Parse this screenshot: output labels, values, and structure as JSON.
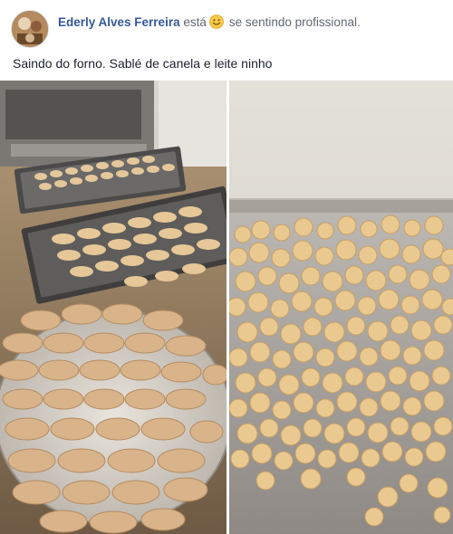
{
  "post": {
    "author": "Ederly Alves Ferreira",
    "verb": "está",
    "feeling_icon": "smiley-emoji-icon",
    "feeling": "se sentindo profissional.",
    "caption": "Saindo do forno. Sablé de canela e leite ninho"
  },
  "photos": [
    {
      "icon": "photo-cookies-trays"
    },
    {
      "icon": "photo-cookies-pan"
    }
  ],
  "colors": {
    "author_link": "#365899",
    "secondary_text": "#616770",
    "text": "#1d2129"
  }
}
